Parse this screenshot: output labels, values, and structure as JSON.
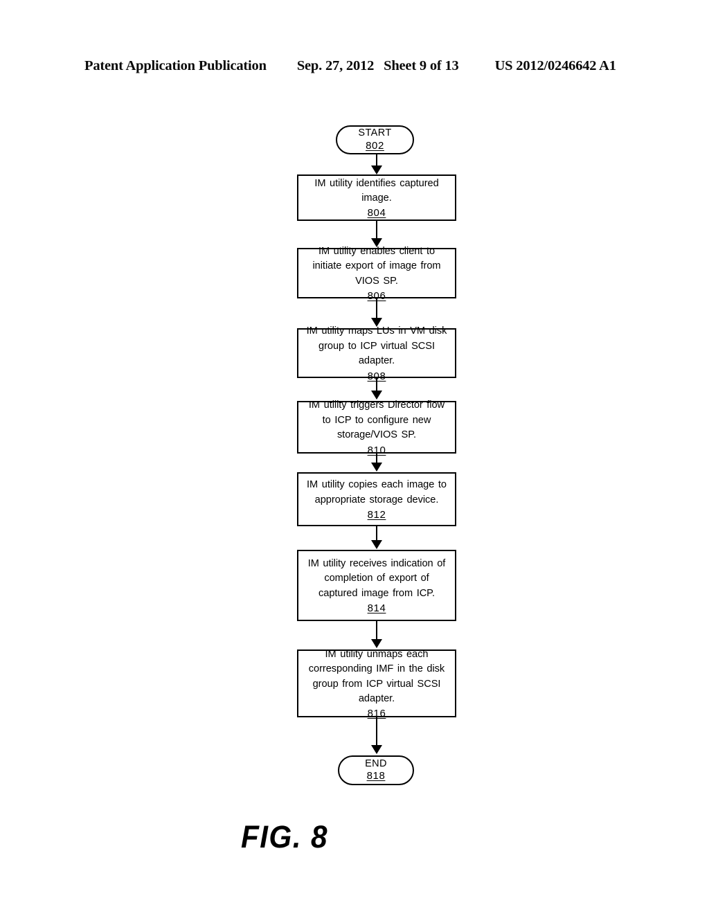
{
  "header": {
    "publication": "Patent Application Publication",
    "date": "Sep. 27, 2012",
    "sheet": "Sheet 9 of 13",
    "patent_number": "US 2012/0246642 A1"
  },
  "figure": {
    "caption": "FIG. 8"
  },
  "flowchart": {
    "start": {
      "label": "START",
      "ref": "802"
    },
    "steps": [
      {
        "ref": "804",
        "text": "IM utility identifies captured image."
      },
      {
        "ref": "806",
        "text": "IM utility enables client to initiate export of image from VIOS SP."
      },
      {
        "ref": "808",
        "text": "IM utility maps LUs in VM disk group to ICP virtual SCSI adapter."
      },
      {
        "ref": "810",
        "text": "IM utility triggers Director flow to ICP to configure new storage/VIOS SP."
      },
      {
        "ref": "812",
        "text": "IM utility copies each image to appropriate storage device."
      },
      {
        "ref": "814",
        "text": "IM utility receives indication of completion of export of captured image from ICP."
      },
      {
        "ref": "816",
        "text": "IM utility unmaps each corresponding IMF in the disk group from ICP virtual SCSI adapter."
      }
    ],
    "end": {
      "label": "END",
      "ref": "818"
    }
  }
}
